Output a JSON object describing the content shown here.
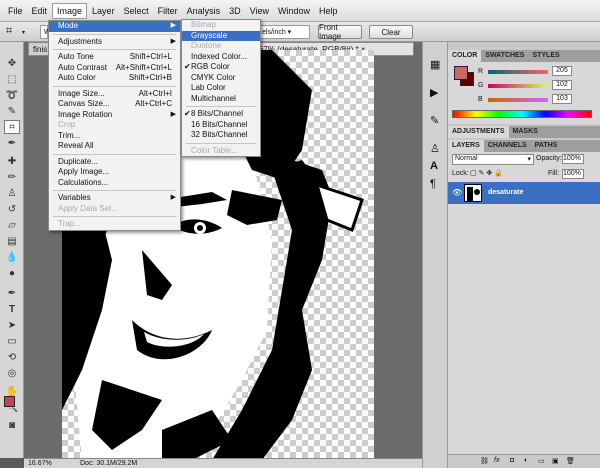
{
  "menubar": [
    "File",
    "Edit",
    "Image",
    "Layer",
    "Select",
    "Filter",
    "Analysis",
    "3D",
    "View",
    "Window",
    "Help"
  ],
  "active_menu": "Image",
  "options": {
    "unit": "els/inch",
    "front_image": "Front Image",
    "clear": "Clear"
  },
  "doc": {
    "tab_left": "finis",
    "tab_title": "67% (desaturate, RGB/8#) *",
    "tab_close": "×"
  },
  "status": {
    "zoom": "16.67%",
    "doc": "Doc: 30.1M/29.2M"
  },
  "image_menu": [
    {
      "label": "Mode",
      "sub": true,
      "hl": true
    },
    {
      "sep": true
    },
    {
      "label": "Adjustments",
      "sub": true
    },
    {
      "sep": true
    },
    {
      "label": "Auto Tone",
      "sc": "Shift+Ctrl+L"
    },
    {
      "label": "Auto Contrast",
      "sc": "Alt+Shift+Ctrl+L"
    },
    {
      "label": "Auto Color",
      "sc": "Shift+Ctrl+B"
    },
    {
      "sep": true
    },
    {
      "label": "Image Size...",
      "sc": "Alt+Ctrl+I"
    },
    {
      "label": "Canvas Size...",
      "sc": "Alt+Ctrl+C"
    },
    {
      "label": "Image Rotation",
      "sub": true
    },
    {
      "label": "Crop",
      "disabled": true
    },
    {
      "label": "Trim..."
    },
    {
      "label": "Reveal All"
    },
    {
      "sep": true
    },
    {
      "label": "Duplicate..."
    },
    {
      "label": "Apply Image..."
    },
    {
      "label": "Calculations..."
    },
    {
      "sep": true
    },
    {
      "label": "Variables",
      "sub": true
    },
    {
      "label": "Apply Data Set...",
      "disabled": true
    },
    {
      "sep": true
    },
    {
      "label": "Trap...",
      "disabled": true
    }
  ],
  "mode_menu": [
    {
      "label": "Bitmap",
      "disabled": true
    },
    {
      "label": "Grayscale",
      "hl": true
    },
    {
      "label": "Duotone",
      "disabled": true
    },
    {
      "label": "Indexed Color..."
    },
    {
      "label": "RGB Color",
      "checked": true
    },
    {
      "label": "CMYK Color"
    },
    {
      "label": "Lab Color"
    },
    {
      "label": "Multichannel"
    },
    {
      "sep": true
    },
    {
      "label": "8 Bits/Channel",
      "checked": true
    },
    {
      "label": "16 Bits/Channel"
    },
    {
      "label": "32 Bits/Channel"
    },
    {
      "sep": true
    },
    {
      "label": "Color Table...",
      "disabled": true
    }
  ],
  "color_panel": {
    "tabs": [
      "COLOR",
      "SWATCHES",
      "STYLES"
    ],
    "r_label": "R",
    "r": "205",
    "g_label": "G",
    "g": "102",
    "b_label": "B",
    "b": "103",
    "fg_color": "#cd6667",
    "bg_color": "#5a0000"
  },
  "adjust_tabs": [
    "ADJUSTMENTS",
    "MASKS"
  ],
  "layers_panel": {
    "tabs": [
      "LAYERS",
      "CHANNELS",
      "PATHS"
    ],
    "blend": "Normal",
    "opacity_label": "Opacity:",
    "opacity": "100%",
    "lock_label": "Lock:",
    "fill_label": "Fill:",
    "fill": "100%",
    "layer_name": "desaturate",
    "footer_icons": [
      "link-icon",
      "fx-icon",
      "mask-icon",
      "adjustment-icon",
      "folder-icon",
      "new-layer-icon",
      "trash-icon"
    ]
  }
}
